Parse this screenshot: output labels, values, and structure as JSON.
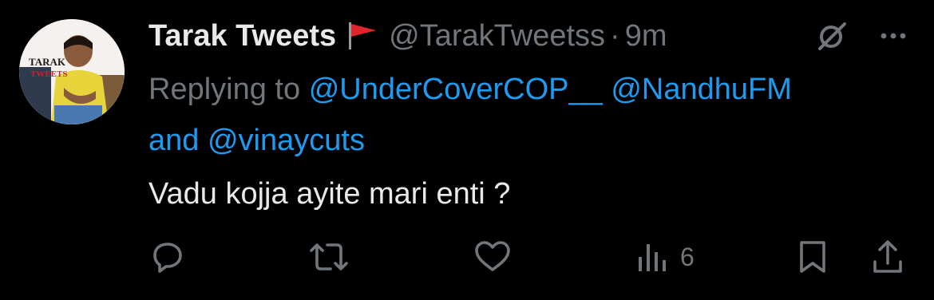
{
  "tweet": {
    "author_name": "Tarak Tweets",
    "handle": "@TarakTweetss",
    "separator": "·",
    "time": "9m",
    "avatar_text_line1": "TARAK",
    "avatar_text_line2": "TWEETS",
    "reply_prefix": "Replying to",
    "mentions": [
      "@UnderCoverCOP__",
      "@NandhuFM",
      "@vinaycuts"
    ],
    "reply_joiner": "and",
    "body": "Vadu kojja ayite mari enti ?",
    "views": "6",
    "flag_color": "#e0242b",
    "accent_color": "#1d9bf0",
    "icons": [
      "flag-icon",
      "grok-icon",
      "more-icon",
      "reply-icon",
      "retweet-icon",
      "like-icon",
      "views-icon",
      "bookmark-icon",
      "share-icon"
    ]
  }
}
